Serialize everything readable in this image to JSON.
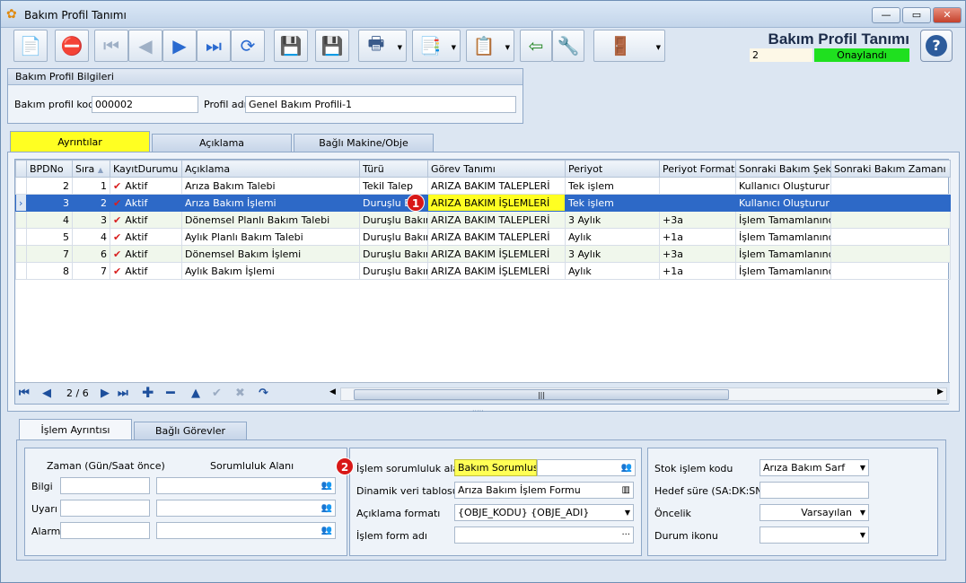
{
  "window": {
    "title": "Bakım Profil Tanımı",
    "min_label": "—",
    "max_label": "▭",
    "close_label": "✕"
  },
  "header": {
    "title": "Bakım Profil Tanımı",
    "record_no": "2",
    "status": "Onaylandı",
    "help_label": "?"
  },
  "toolbar": {
    "icons": [
      "new-record-icon",
      "delete-record-icon",
      "first-record-icon",
      "previous-record-icon",
      "next-record-icon",
      "last-record-icon",
      "refresh-icon",
      "save-icon",
      "cancel-save-icon",
      "print-icon",
      "pdf-export-icon",
      "copy-icon",
      "import-icon",
      "settings-tool-icon",
      "exit-door-icon"
    ]
  },
  "profile_info": {
    "group_title": "Bakım Profil Bilgileri",
    "code_label": "Bakım profil kodu",
    "code_value": "000002",
    "name_label": "Profil adı",
    "name_value": "Genel Bakım Profili-1"
  },
  "tabs": {
    "details": "Ayrıntılar",
    "description": "Açıklama",
    "linked": "Bağlı Makine/Obje"
  },
  "grid": {
    "columns": [
      "BPDNo",
      "Sıra",
      "KayıtDurumu",
      "Açıklama",
      "Türü",
      "Görev Tanımı",
      "Periyot",
      "Periyot Formatı",
      "Sonraki Bakım Şekli",
      "Sonraki Bakım Zamanı (Gün"
    ],
    "rows": [
      {
        "bpdno": "2",
        "sira": "1",
        "durum": "Aktif",
        "aciklama": "Arıza Bakım Talebi",
        "turu": "Tekil Talep",
        "gorev": "ARIZA BAKIM TALEPLERİ",
        "periyot": "Tek işlem",
        "format": "",
        "sekil": "Kullanıcı Oluşturur",
        "zaman": ""
      },
      {
        "bpdno": "3",
        "sira": "2",
        "durum": "Aktif",
        "aciklama": "Arıza Bakım İşlemi",
        "turu": "Duruşlu Bak",
        "gorev": "ARIZA BAKIM İŞLEMLERİ",
        "periyot": "Tek işlem",
        "format": "",
        "sekil": "Kullanıcı Oluşturur",
        "zaman": ""
      },
      {
        "bpdno": "4",
        "sira": "3",
        "durum": "Aktif",
        "aciklama": "Dönemsel Planlı Bakım Talebi",
        "turu": "Duruşlu Bakım",
        "gorev": "ARIZA BAKIM TALEPLERİ",
        "periyot": "3 Aylık",
        "format": "+3a",
        "sekil": "İşlem Tamamlanınca",
        "zaman": ""
      },
      {
        "bpdno": "5",
        "sira": "4",
        "durum": "Aktif",
        "aciklama": "Aylık Planlı Bakım Talebi",
        "turu": "Duruşlu Bakım",
        "gorev": "ARIZA BAKIM TALEPLERİ",
        "periyot": "Aylık",
        "format": "+1a",
        "sekil": "İşlem Tamamlanınca",
        "zaman": ""
      },
      {
        "bpdno": "7",
        "sira": "6",
        "durum": "Aktif",
        "aciklama": "Dönemsel Bakım İşlemi",
        "turu": "Duruşlu Bakım",
        "gorev": "ARIZA BAKIM İŞLEMLERİ",
        "periyot": "3 Aylık",
        "format": "+3a",
        "sekil": "İşlem Tamamlanınca",
        "zaman": ""
      },
      {
        "bpdno": "8",
        "sira": "7",
        "durum": "Aktif",
        "aciklama": "Aylık Bakım İşlemi",
        "turu": "Duruşlu Bakım",
        "gorev": "ARIZA BAKIM İŞLEMLERİ",
        "periyot": "Aylık",
        "format": "+1a",
        "sekil": "İşlem Tamamlanınca",
        "zaman": ""
      }
    ],
    "selected_row": 1,
    "nav_position": "2 / 6",
    "badge_1": "1"
  },
  "bottom_tabs": {
    "detail": "İşlem Ayrıntısı",
    "linked_tasks": "Bağlı Görevler"
  },
  "timing": {
    "col_time": "Zaman (Gün/Saat önce)",
    "col_resp": "Sorumluluk Alanı",
    "info_label": "Bilgi",
    "warn_label": "Uyarı",
    "alarm_label": "Alarm"
  },
  "process": {
    "badge_2": "2",
    "resp_label": "İşlem sorumluluk alanı",
    "resp_value": "Bakım Sorumlusu",
    "dyn_label": "Dinamik veri tablosu",
    "dyn_value": "Arıza Bakım İşlem Formu",
    "desc_label": "Açıklama formatı",
    "desc_value": "{OBJE_KODU} {OBJE_ADI}",
    "form_label": "İşlem form adı",
    "form_value": ""
  },
  "stock": {
    "code_label": "Stok işlem kodu",
    "code_value": "Arıza Bakım Sarf",
    "target_label": "Hedef süre (SA:DK:SN)",
    "target_value": "",
    "priority_label": "Öncelik",
    "priority_value": "Varsayılan",
    "icon_label": "Durum ikonu",
    "icon_value": ""
  },
  "colors": {
    "selected_row": "#2d69c7",
    "highlight": "#ffff22",
    "status_green": "#1fe01f",
    "badge_red": "#d81818"
  }
}
